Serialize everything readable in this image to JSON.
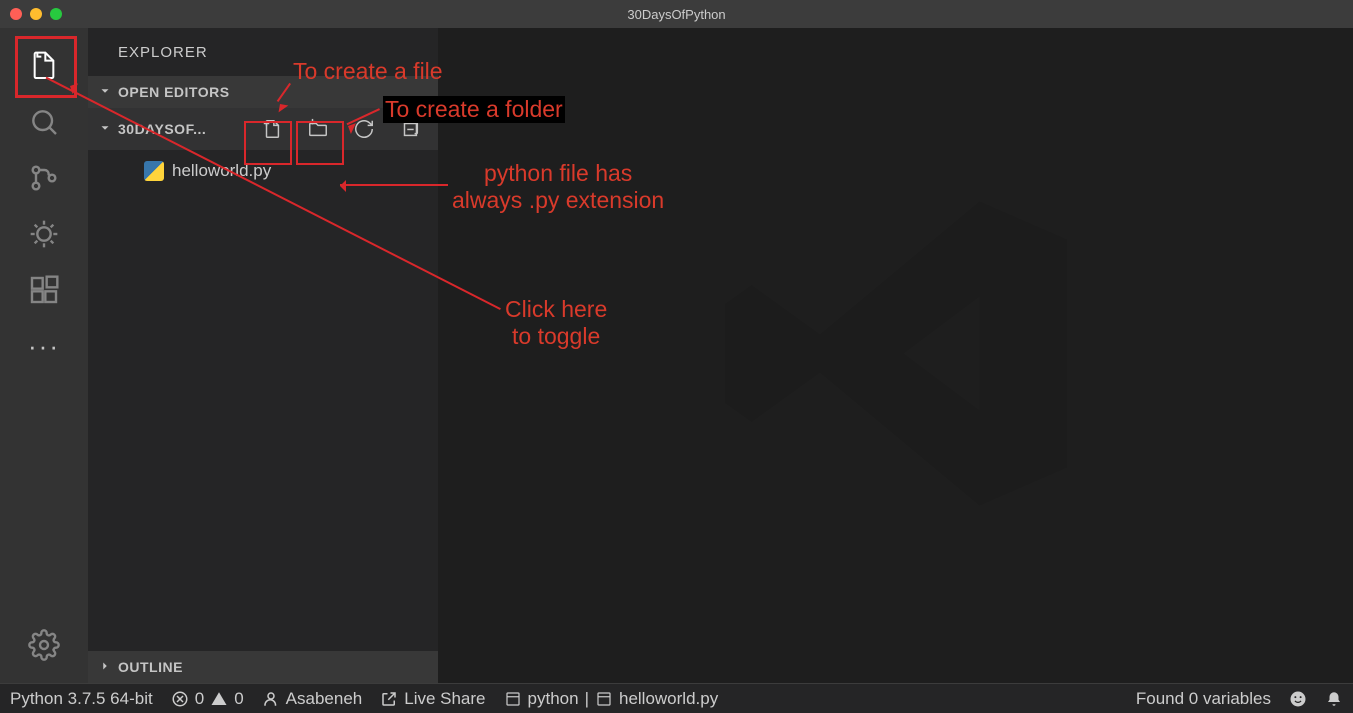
{
  "window": {
    "title": "30DaysOfPython"
  },
  "explorer": {
    "title": "EXPLORER",
    "open_editors_label": "OPEN EDITORS",
    "folder_label": "30DAYSOF...",
    "outline_label": "OUTLINE",
    "files": [
      {
        "name": "helloworld.py",
        "icon": "python"
      }
    ]
  },
  "status": {
    "python_version": "Python 3.7.5 64-bit",
    "errors": "0",
    "warnings": "0",
    "account": "Asabeneh",
    "live_share": "Live Share",
    "environment": "python",
    "file": "helloworld.py",
    "variables": "Found 0 variables"
  },
  "annotations": {
    "create_file": "To create a file",
    "create_folder": "To create a folder",
    "py_extension_l1": "python file has",
    "py_extension_l2": "always .py extension",
    "toggle_l1": "Click here",
    "toggle_l2": "to toggle"
  }
}
